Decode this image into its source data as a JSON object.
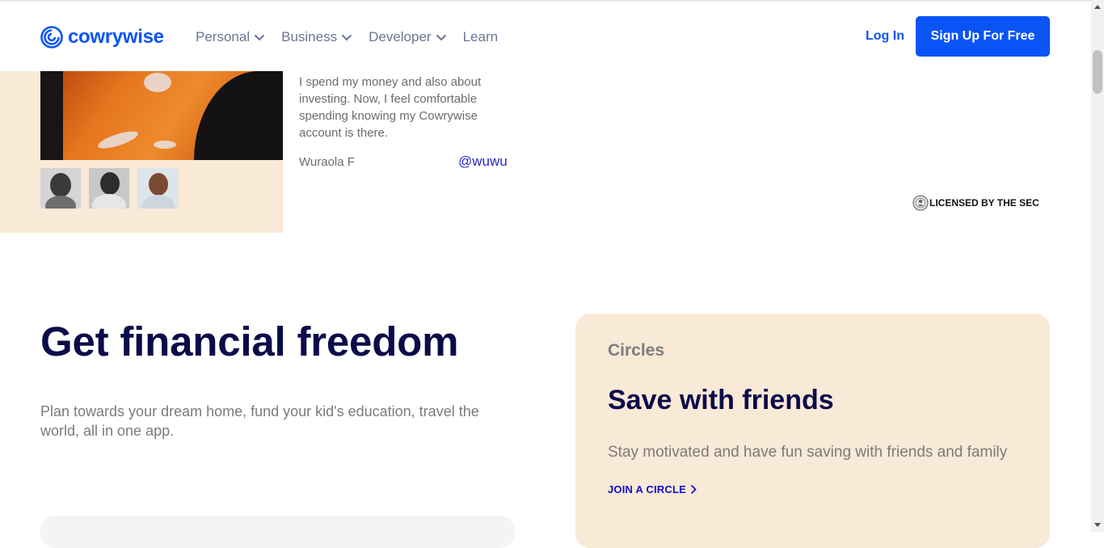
{
  "header": {
    "logo_text": "cowrywise",
    "nav": [
      {
        "label": "Personal",
        "has_dropdown": true
      },
      {
        "label": "Business",
        "has_dropdown": true
      },
      {
        "label": "Developer",
        "has_dropdown": true
      },
      {
        "label": "Learn",
        "has_dropdown": false
      }
    ],
    "login_label": "Log In",
    "signup_label": "Sign Up For Free"
  },
  "testimonial": {
    "quote": "I spend my money and also about investing. Now, I feel comfortable spending knowing my Cowrywise account is there.",
    "author": "Wuraola F",
    "handle": "@wuwu"
  },
  "license": {
    "text": "LICENSED BY THE SEC",
    "icon": "sec-seal-icon"
  },
  "freedom": {
    "title": "Get financial freedom",
    "lead": "Plan towards your dream home, fund your kid's education, travel the world, all in one app."
  },
  "circles_card": {
    "eyebrow": "Circles",
    "title": "Save with friends",
    "description": "Stay motivated and have fun saving with friends and family",
    "link_label": "JOIN A CIRCLE"
  },
  "colors": {
    "brand_blue": "#0a54f6",
    "navy": "#0b0b4a",
    "peach": "#f9e9d7",
    "link_blue": "#1010c8"
  }
}
